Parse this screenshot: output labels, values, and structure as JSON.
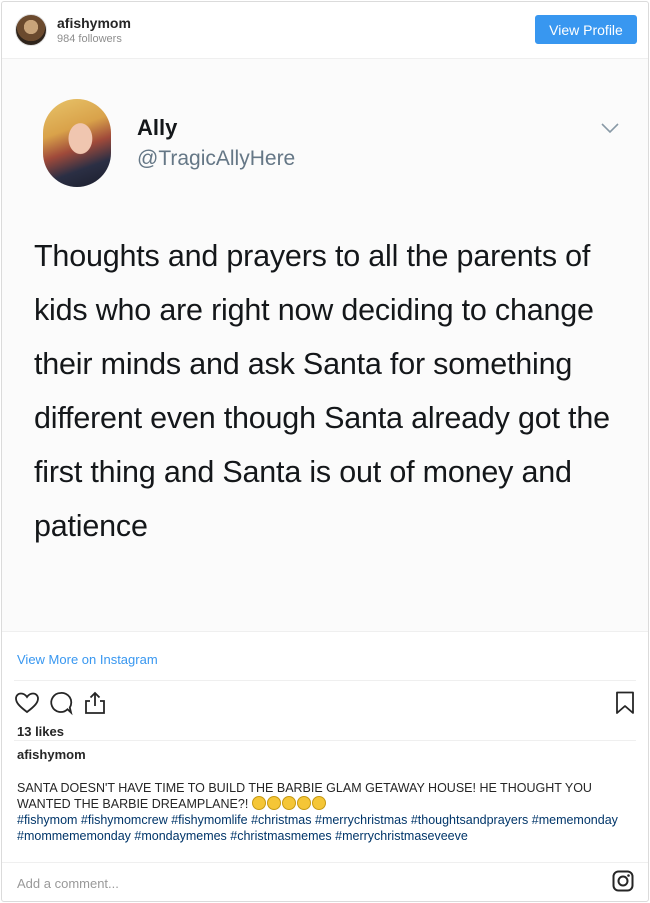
{
  "header": {
    "username": "afishymom",
    "followers": "984 followers",
    "view_profile_label": "View Profile"
  },
  "tweet": {
    "name": "Ally",
    "handle": "@TragicAllyHere",
    "text": "Thoughts and prayers to all the parents of kids who are right now deciding to change their minds and ask Santa for something different even though Santa already got the first thing and Santa is out of money and patience"
  },
  "footer": {
    "view_more_label": "View More on Instagram",
    "likes": "13 likes",
    "caption_user": "afishymom",
    "caption_text": "SANTA DOESN'T HAVE TIME TO BUILD THE BARBIE GLAM GETAWAY HOUSE! HE THOUGHT YOU WANTED THE BARBIE DREAMPLANE?!",
    "hashtags": "#fishymom #fishymomcrew #fishymomlife #christmas #merrychristmas #thoughtsandprayers #mememonday #mommememonday #mondaymemes #christmasmemes #merrychristmaseveeve",
    "comment_placeholder": "Add a comment..."
  },
  "icons": [
    "heart-icon",
    "comment-icon",
    "share-icon",
    "bookmark-icon",
    "instagram-icon",
    "chevron-down-icon"
  ],
  "colors": {
    "accent": "#3897f0",
    "hashtag": "#003569"
  }
}
